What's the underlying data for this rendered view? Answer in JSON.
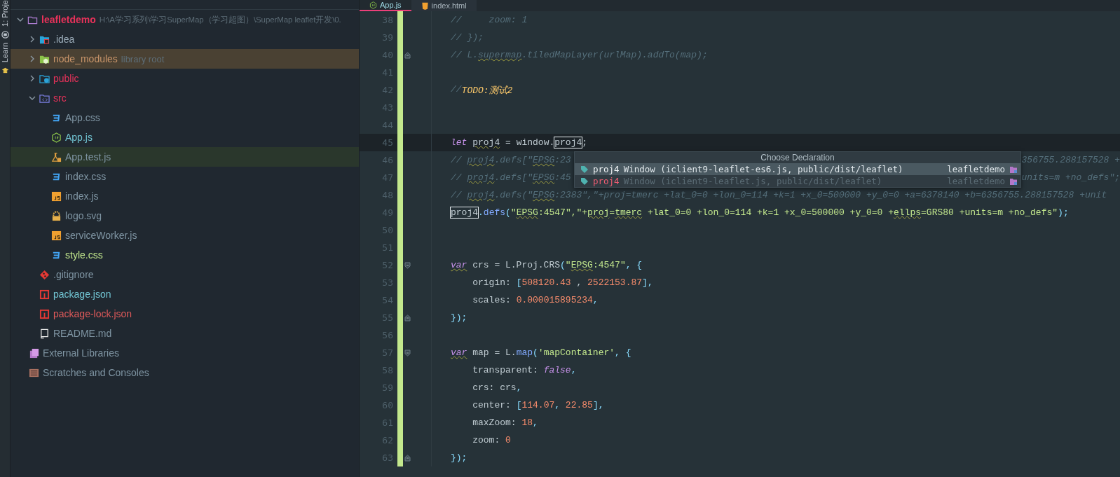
{
  "tool_strip": [
    {
      "label": "1: Proje",
      "kind": "project"
    },
    {
      "label": "Learn",
      "kind": "learn"
    }
  ],
  "editor_tabs": [
    {
      "label": "App.js",
      "kind": "nodejs",
      "selected": true
    },
    {
      "label": "index.html",
      "kind": "html",
      "selected": false
    }
  ],
  "project_tree": [
    {
      "label": "leafletdemo",
      "hint": "H:\\A学习系列\\学习SuperMap（学习超图）\\SuperMap leaflet开发\\0.",
      "kind": "root",
      "color": "#e8325a",
      "expanded": true,
      "children": [
        {
          "label": ".idea",
          "kind": "idea-folder",
          "color": "#9aabb8",
          "expanded": false
        },
        {
          "label": "node_modules",
          "hint": "library root",
          "kind": "library-folder",
          "color": "#c9956a",
          "expanded": false
        },
        {
          "label": "public",
          "kind": "web-folder",
          "color": "#e8325a",
          "expanded": false
        },
        {
          "label": "src",
          "kind": "source-folder",
          "color": "#e8325a",
          "expanded": true,
          "children": [
            {
              "label": "App.css",
              "kind": "css",
              "color": "#7f95a3"
            },
            {
              "label": "App.js",
              "kind": "nodejs",
              "color": "#72c6d4"
            },
            {
              "label": "App.test.js",
              "kind": "test",
              "color": "#7f95a3"
            },
            {
              "label": "index.css",
              "kind": "css",
              "color": "#7f95a3"
            },
            {
              "label": "index.js",
              "kind": "js",
              "color": "#7f95a3"
            },
            {
              "label": "logo.svg",
              "kind": "svg",
              "color": "#7f95a3"
            },
            {
              "label": "serviceWorker.js",
              "kind": "js",
              "color": "#7f95a3"
            },
            {
              "label": "style.css",
              "kind": "css",
              "color": "#c3e88d"
            }
          ]
        },
        {
          "label": ".gitignore",
          "kind": "git",
          "color": "#7f95a3"
        },
        {
          "label": "package.json",
          "kind": "npm",
          "color": "#72c6d4"
        },
        {
          "label": "package-lock.json",
          "kind": "npm",
          "color": "#e05a5a"
        },
        {
          "label": "README.md",
          "kind": "readme",
          "color": "#7f95a3"
        }
      ]
    },
    {
      "label": "External Libraries",
      "kind": "libraries",
      "color": "#7f95a3"
    },
    {
      "label": "Scratches and Consoles",
      "kind": "scratches",
      "color": "#7f95a3"
    }
  ],
  "code_lines": [
    {
      "n": "38",
      "current": false,
      "tokens": [
        {
          "text": "//     zoom: 1",
          "kind": "comment"
        }
      ]
    },
    {
      "n": "39",
      "current": false,
      "tokens": [
        {
          "text": "// });",
          "kind": "comment"
        }
      ]
    },
    {
      "n": "40",
      "fold_marker": {
        "kind": "end"
      },
      "current": false,
      "tokens": [
        {
          "text": "// L.",
          "kind": "comment"
        },
        {
          "text": "supermap",
          "kind": "comment",
          "squiggle": true
        },
        {
          "text": ".tiledMapLayer(urlMap).addTo(map);",
          "kind": "comment"
        }
      ]
    },
    {
      "n": "41",
      "current": false
    },
    {
      "n": "42",
      "current": false,
      "tokens": [
        {
          "text": "//",
          "kind": "comment"
        },
        {
          "text": "TODO:测试2",
          "kind": "todo"
        }
      ]
    },
    {
      "n": "43",
      "current": false
    },
    {
      "n": "44",
      "current": false
    },
    {
      "n": "45",
      "current": true,
      "tokens": [
        {
          "text": "let ",
          "kind": "keyword"
        },
        {
          "text": "proj4",
          "kind": "plain",
          "squiggle": true
        },
        {
          "text": " = window.",
          "kind": "plain"
        },
        {
          "text": "proj4",
          "kind": "usage"
        },
        {
          "text": ";",
          "kind": "plain"
        }
      ]
    },
    {
      "n": "46",
      "current": false,
      "tokens": [
        {
          "text": "// ",
          "kind": "comment"
        },
        {
          "text": "proj4",
          "kind": "comment",
          "squiggle": true
        },
        {
          "text": ".defs[\"",
          "kind": "comment"
        },
        {
          "text": "EPSG",
          "kind": "comment",
          "squiggle": true
        },
        {
          "text": ":23",
          "kind": "comment"
        }
      ],
      "tail": [
        {
          "text": "356755.288157528 +",
          "kind": "comment"
        }
      ]
    },
    {
      "n": "47",
      "current": false,
      "tokens": [
        {
          "text": "// ",
          "kind": "comment"
        },
        {
          "text": "proj4",
          "kind": "comment",
          "squiggle": true
        },
        {
          "text": ".defs[\"",
          "kind": "comment"
        },
        {
          "text": "EPSG",
          "kind": "comment",
          "squiggle": true
        },
        {
          "text": ":45",
          "kind": "comment"
        }
      ],
      "tail": [
        {
          "text": "units=m +no_defs\";",
          "kind": "comment"
        }
      ]
    },
    {
      "n": "48",
      "current": false,
      "tokens": [
        {
          "text": "// ",
          "kind": "comment"
        },
        {
          "text": "proj4",
          "kind": "comment",
          "squiggle": true
        },
        {
          "text": ".defs(\"",
          "kind": "comment"
        },
        {
          "text": "EPSG",
          "kind": "comment",
          "squiggle": true
        },
        {
          "text": ":2383\",\"+proj=tmerc +lat_0=0 +lon_0=114 +k=1 +x_0=500000 +y_0=0 +a=6378140 +b=6356755.288157528 +unit",
          "kind": "comment"
        }
      ]
    },
    {
      "n": "49",
      "current": false,
      "tokens": [
        {
          "text": "proj4",
          "kind": "usage"
        },
        {
          "text": ".",
          "kind": "punctuation"
        },
        {
          "text": "defs",
          "kind": "function"
        },
        {
          "text": "(",
          "kind": "punctuation"
        },
        {
          "text": "\"",
          "kind": "string"
        },
        {
          "text": "EPSG",
          "kind": "string",
          "squiggle": true
        },
        {
          "text": ":4547\",\"+",
          "kind": "string"
        },
        {
          "text": "proj",
          "kind": "string",
          "squiggle": true
        },
        {
          "text": "=",
          "kind": "string"
        },
        {
          "text": "tmerc",
          "kind": "string",
          "squiggle": true
        },
        {
          "text": " +lat_0=0 +lon_0=114 +k=1 +x_0=500000 +y_0=0 +",
          "kind": "string"
        },
        {
          "text": "ellps",
          "kind": "string",
          "squiggle": true
        },
        {
          "text": "=GRS80 +units=m +no_defs\"",
          "kind": "string"
        },
        {
          "text": ");",
          "kind": "punctuation"
        }
      ]
    },
    {
      "n": "50",
      "current": false
    },
    {
      "n": "51",
      "current": false
    },
    {
      "n": "52",
      "fold_marker": {
        "kind": "start"
      },
      "current": false,
      "tokens": [
        {
          "text": "var",
          "kind": "keyword",
          "squiggle": true
        },
        {
          "text": " crs = L.Proj.CRS",
          "kind": "plain"
        },
        {
          "text": "(",
          "kind": "punctuation"
        },
        {
          "text": "\"",
          "kind": "string"
        },
        {
          "text": "EPSG",
          "kind": "string",
          "squiggle": true
        },
        {
          "text": ":4547\"",
          "kind": "string"
        },
        {
          "text": ", {",
          "kind": "punctuation"
        }
      ]
    },
    {
      "n": "53",
      "current": false,
      "tokens": [
        {
          "text": "    origin: ",
          "kind": "plain"
        },
        {
          "text": "[",
          "kind": "punctuation"
        },
        {
          "text": "508120.43",
          "kind": "number"
        },
        {
          "text": " , ",
          "kind": "plain"
        },
        {
          "text": "2522153.87",
          "kind": "number"
        },
        {
          "text": "],",
          "kind": "punctuation"
        }
      ]
    },
    {
      "n": "54",
      "current": false,
      "tokens": [
        {
          "text": "    scales: ",
          "kind": "plain"
        },
        {
          "text": "0.000015895234",
          "kind": "number"
        },
        {
          "text": ",",
          "kind": "punctuation"
        }
      ]
    },
    {
      "n": "55",
      "fold_marker": {
        "kind": "end"
      },
      "current": false,
      "tokens": [
        {
          "text": "});",
          "kind": "punctuation"
        }
      ]
    },
    {
      "n": "56",
      "current": false
    },
    {
      "n": "57",
      "fold_marker": {
        "kind": "start"
      },
      "current": false,
      "tokens": [
        {
          "text": "var",
          "kind": "keyword",
          "squiggle": true
        },
        {
          "text": " map = L.",
          "kind": "plain"
        },
        {
          "text": "map",
          "kind": "function"
        },
        {
          "text": "(",
          "kind": "punctuation"
        },
        {
          "text": "'mapContainer'",
          "kind": "string"
        },
        {
          "text": ", {",
          "kind": "punctuation"
        }
      ]
    },
    {
      "n": "58",
      "current": false,
      "tokens": [
        {
          "text": "    transparent: ",
          "kind": "plain"
        },
        {
          "text": "false",
          "kind": "keyword"
        },
        {
          "text": ",",
          "kind": "punctuation"
        }
      ]
    },
    {
      "n": "59",
      "current": false,
      "tokens": [
        {
          "text": "    crs: crs",
          "kind": "plain"
        },
        {
          "text": ",",
          "kind": "punctuation"
        }
      ]
    },
    {
      "n": "60",
      "current": false,
      "tokens": [
        {
          "text": "    center: ",
          "kind": "plain"
        },
        {
          "text": "[",
          "kind": "punctuation"
        },
        {
          "text": "114.07",
          "kind": "number"
        },
        {
          "text": ", ",
          "kind": "punctuation"
        },
        {
          "text": "22.85",
          "kind": "number"
        },
        {
          "text": "],",
          "kind": "punctuation"
        }
      ]
    },
    {
      "n": "61",
      "current": false,
      "tokens": [
        {
          "text": "    maxZoom: ",
          "kind": "plain"
        },
        {
          "text": "18",
          "kind": "number"
        },
        {
          "text": ",",
          "kind": "punctuation"
        }
      ]
    },
    {
      "n": "62",
      "current": false,
      "tokens": [
        {
          "text": "    zoom: ",
          "kind": "plain"
        },
        {
          "text": "0",
          "kind": "number"
        }
      ]
    },
    {
      "n": "63",
      "fold_marker": {
        "kind": "end"
      },
      "current": false,
      "tokens": [
        {
          "text": "});",
          "kind": "punctuation"
        }
      ]
    }
  ],
  "declaration_popup": {
    "title": "Choose Declaration",
    "items": [
      {
        "name": "proj4",
        "detail": "Window (iclient9-leaflet-es6.js, public/dist/leaflet)",
        "module": "leafletdemo",
        "selected": true,
        "disabled": false
      },
      {
        "name": "proj4",
        "detail": "Window (iclient9-leaflet.js, public/dist/leaflet)",
        "module": "leafletdemo",
        "selected": false,
        "disabled": true
      }
    ]
  }
}
